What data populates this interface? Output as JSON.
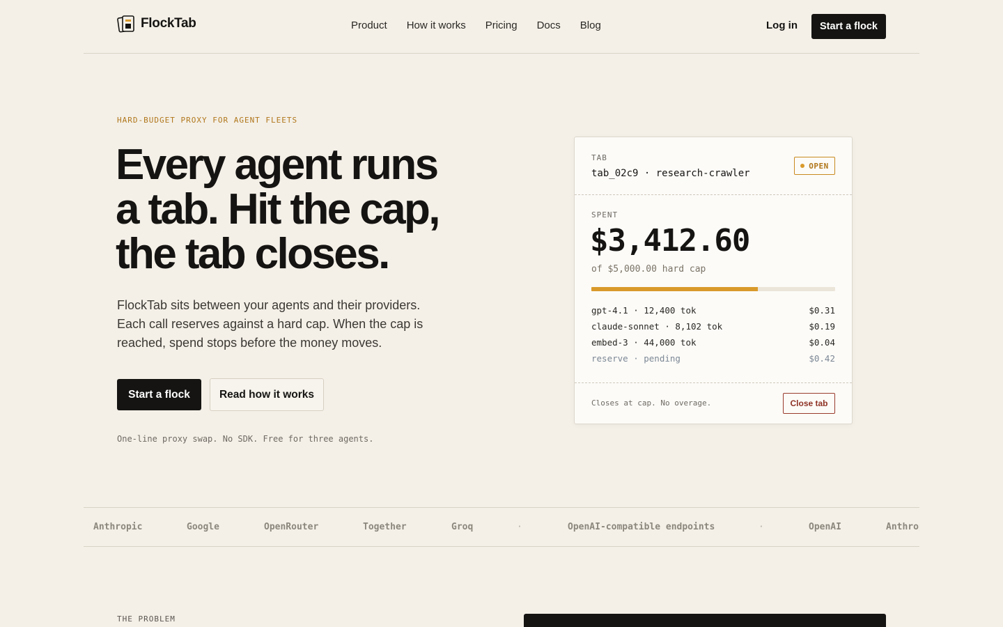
{
  "nav": {
    "brand": "FlockTab",
    "links": [
      "Product",
      "How it works",
      "Pricing",
      "Docs",
      "Blog"
    ],
    "login": "Log in",
    "cta": "Start a flock"
  },
  "hero": {
    "eyebrow": "HARD-BUDGET PROXY FOR AGENT FLEETS",
    "headline_lines": [
      "Every agent runs",
      "a tab. Hit the cap,",
      "the tab closes."
    ],
    "subtext": "FlockTab sits between your agents and their providers. Each call reserves against a hard cap. When the cap is reached, spend stops before the money moves.",
    "primary_cta": "Start a flock",
    "secondary_cta": "Read how it works",
    "footnote": "One-line proxy swap. No SDK. Free for three agents."
  },
  "tab_card": {
    "tab_label": "TAB",
    "tab_id": "tab_02c9 · research-crawler",
    "status": "OPEN",
    "spent_label": "SPENT",
    "spent": "$3,412.60",
    "cap_text": "of $5,000.00 hard cap",
    "progress_fraction": 0.6825,
    "lines": [
      {
        "label": "gpt-4.1 · 12,400 tok",
        "amount": "$0.31"
      },
      {
        "label": "claude-sonnet · 8,102 tok",
        "amount": "$0.19"
      },
      {
        "label": "embed-3 · 44,000 tok",
        "amount": "$0.04"
      },
      {
        "label": "reserve · pending",
        "amount": "$0.42"
      }
    ],
    "footer_note": "Closes at cap. No overage.",
    "close_button": "Close tab"
  },
  "providers": [
    "Anthropic",
    "Google",
    "OpenRouter",
    "Together",
    "Groq",
    "·",
    "OpenAI-compatible endpoints",
    "·",
    "OpenAI",
    "Anthropic"
  ],
  "next_section": {
    "label": "THE PROBLEM"
  },
  "colors": {
    "background": "#f4f0e8",
    "ink": "#151412",
    "accent": "#d99a2b",
    "danger": "#9a3b2c"
  }
}
